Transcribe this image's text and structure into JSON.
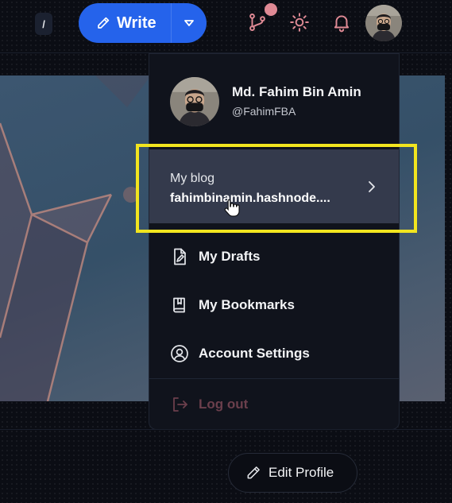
{
  "topbar": {
    "kbd_shortcut": "/",
    "write_label": "Write",
    "icons": [
      "pencil-icon",
      "caret-down-icon",
      "git-branch-icon",
      "sun-icon",
      "bell-icon"
    ]
  },
  "dropdown": {
    "user": {
      "name": "Md. Fahim Bin Amin",
      "handle": "@FahimFBA"
    },
    "blog": {
      "label": "My blog",
      "url": "fahimbinamin.hashnode...."
    },
    "items": [
      {
        "label": "My Drafts",
        "icon": "draft-file-icon"
      },
      {
        "label": "My Bookmarks",
        "icon": "bookmark-book-icon"
      },
      {
        "label": "Account Settings",
        "icon": "user-circle-icon"
      }
    ],
    "logout_label": "Log out"
  },
  "profile": {
    "edit_label": "Edit Profile"
  },
  "colors": {
    "background": "#0b0d14",
    "accent": "#2563eb",
    "highlight": "#f2e51f",
    "notification": "#e08a95",
    "logout": "#6b3f4c",
    "selected_item": "#343a4c"
  }
}
